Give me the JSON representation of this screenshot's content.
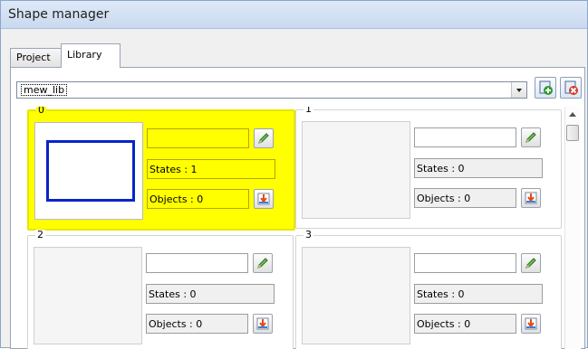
{
  "window": {
    "title": "Shape manager"
  },
  "tabs": [
    {
      "label": "Project"
    },
    {
      "label": "Library"
    }
  ],
  "library_select": {
    "value": "mew_lib"
  },
  "toolbar": {
    "new_icon": "new-library-icon",
    "delete_icon": "delete-library-icon"
  },
  "cells": [
    {
      "number": "0",
      "name": "",
      "states": "States : 1",
      "objects": "Objects : 0",
      "selected": true
    },
    {
      "number": "1",
      "name": "",
      "states": "States : 0",
      "objects": "Objects : 0",
      "selected": false
    },
    {
      "number": "2",
      "name": "",
      "states": "States : 0",
      "objects": "Objects : 0",
      "selected": false
    },
    {
      "number": "3",
      "name": "",
      "states": "States : 0",
      "objects": "Objects : 0",
      "selected": false
    }
  ],
  "colors": {
    "selected_bg": "#ffff00",
    "shape_border": "#0a24c9"
  }
}
